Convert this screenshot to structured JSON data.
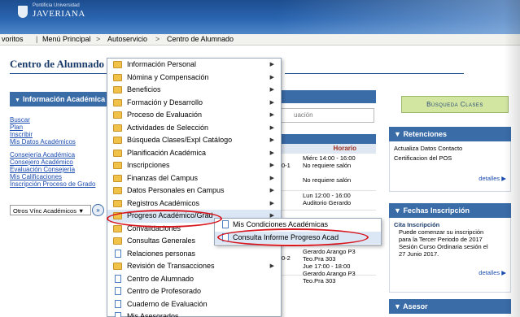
{
  "banner": {
    "logo_small": "Pontificia Universidad",
    "logo_main": "JAVERIANA"
  },
  "navbar": {
    "favoritos": "voritos",
    "menu_principal": "Menú Principal",
    "autoservicio": "Autoservicio",
    "centro": "Centro de Alumnado",
    "sep": ">"
  },
  "page_title": "Centro de Alumnado",
  "left_panel": {
    "heading": "Información Académica",
    "links_a": [
      "Buscar",
      "Plan",
      "Inscribir",
      "Mis Datos Académicos"
    ],
    "links_b": [
      "Consejería Académica",
      "Consejero Académico",
      "Evaluación Consejería",
      "Mis Calificaciones",
      "Inscripción Proceso de Grado"
    ],
    "otros_select": "Otros Vínc Académicos"
  },
  "mid": {
    "search_partial": "uación",
    "col_horario": "Horario",
    "rows": [
      {
        "code": "0-1",
        "lines": [
          "Miérc 14:00 - 16:00",
          "No requiere salón",
          "",
          "No requiere salón"
        ]
      },
      {
        "code": "",
        "lines": [
          "Lun 12:00 - 16:00",
          "Auditorio Gerardo"
        ]
      },
      {
        "code": "0-2",
        "lines": [
          "Gerardo Arango P3",
          "Teo.Pra 303",
          "Jue 17:00 - 18:00",
          "Gerardo Arango P3",
          "Teo.Pra 303"
        ]
      }
    ]
  },
  "menu": {
    "items": [
      {
        "label": "Información Personal",
        "icon": "folder-icon",
        "arrow": true
      },
      {
        "label": "Nómina y Compensación",
        "icon": "folder-icon",
        "arrow": true
      },
      {
        "label": "Beneficios",
        "icon": "folder-icon",
        "arrow": true
      },
      {
        "label": "Formación y Desarrollo",
        "icon": "folder-icon",
        "arrow": true
      },
      {
        "label": "Proceso de Evaluación",
        "icon": "folder-icon",
        "arrow": true
      },
      {
        "label": "Actividades de Selección",
        "icon": "folder-icon",
        "arrow": true
      },
      {
        "label": "Búsqueda Clases/Expl Catálogo",
        "icon": "folder-icon",
        "arrow": true
      },
      {
        "label": "Planificación Académica",
        "icon": "folder-icon",
        "arrow": true
      },
      {
        "label": "Inscripciones",
        "icon": "folder-icon",
        "arrow": true
      },
      {
        "label": "Finanzas del Campus",
        "icon": "folder-icon",
        "arrow": true
      },
      {
        "label": "Datos Personales en Campus",
        "icon": "folder-icon",
        "arrow": true
      },
      {
        "label": "Registros Académicos",
        "icon": "folder-icon",
        "arrow": true
      },
      {
        "label": "Progreso Académico/Grad",
        "icon": "folder-icon",
        "arrow": true
      },
      {
        "label": "Convalidaciones",
        "icon": "folder-icon",
        "arrow": true
      },
      {
        "label": "Consultas Generales",
        "icon": "folder-icon",
        "arrow": true
      },
      {
        "label": "Relaciones personas",
        "icon": "page-icon",
        "arrow": false
      },
      {
        "label": "Revisión de Transacciones",
        "icon": "folder-icon",
        "arrow": true
      },
      {
        "label": "Centro de Alumnado",
        "icon": "page-icon",
        "arrow": false
      },
      {
        "label": "Centro de Profesorado",
        "icon": "page-icon",
        "arrow": false
      },
      {
        "label": "Cuaderno de Evaluación",
        "icon": "page-icon",
        "arrow": false
      },
      {
        "label": "Mis Asesorados",
        "icon": "page-icon",
        "arrow": false
      }
    ]
  },
  "submenu": {
    "items": [
      {
        "label": "Mis Condiciones Académicas"
      },
      {
        "label": "Consulta Informe Progreso Acad"
      }
    ]
  },
  "right": {
    "busqueda_button": "Búsqueda Clases",
    "retenciones": {
      "heading": "Retenciones",
      "lines": [
        "Actualiza Datos Contacto",
        "Certificacion del POS"
      ],
      "detalles": "detalles"
    },
    "fechas": {
      "heading": "Fechas Inscripción",
      "cita_title": "Cita Inscripción",
      "cita_text": [
        "Puede comenzar su inscripción",
        "para la Tercer Periodo de 2017",
        "Sesión Curso Ordinaria sesión el",
        "27 Junio 2017."
      ],
      "detalles": "detalles"
    },
    "asesor": {
      "heading": "Asesor"
    }
  },
  "colors": {
    "accent_blue": "#3a6ca8",
    "highlight_red": "#d8141c",
    "button_green": "#d2e6a2"
  }
}
